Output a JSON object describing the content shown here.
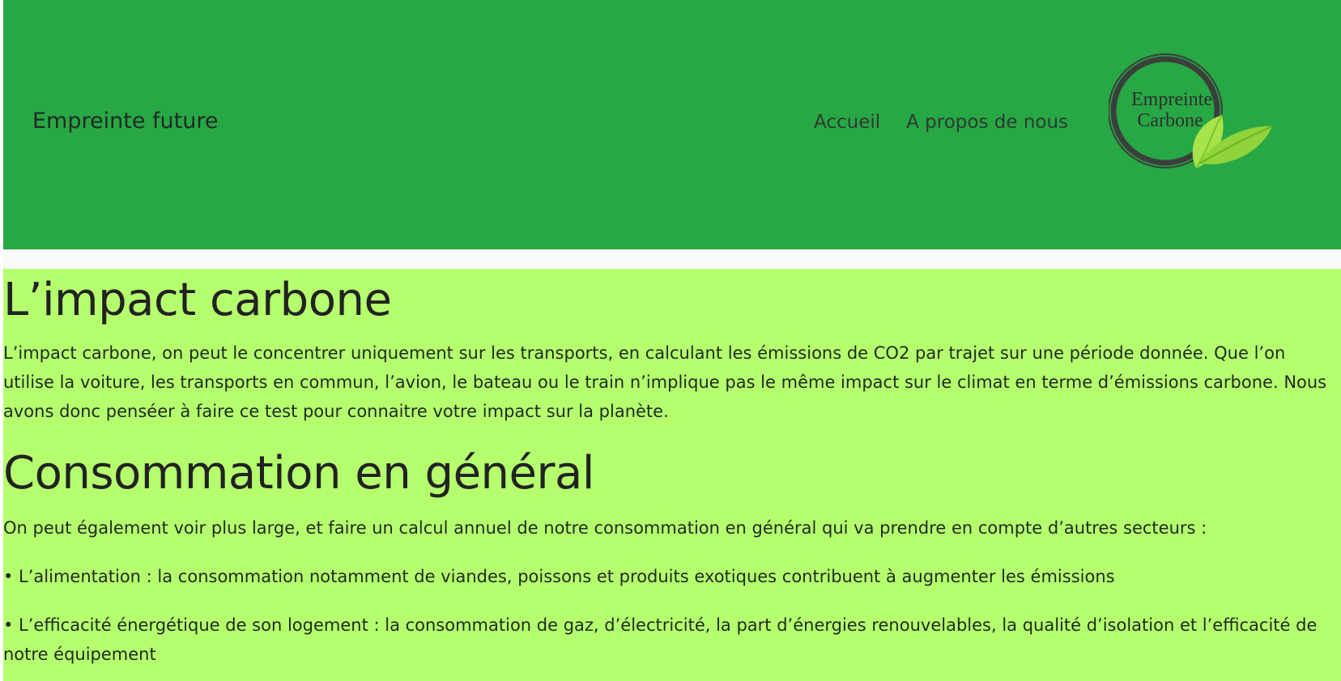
{
  "header": {
    "brand": "Empreinte future",
    "nav": {
      "home": "Accueil",
      "about": "A propos de nous"
    },
    "logo": {
      "line1": "Empreinte",
      "line2": "Carbone"
    }
  },
  "sections": {
    "impact": {
      "title": "L’impact carbone",
      "text": "L’impact carbone, on peut le concentrer uniquement sur les transports, en calculant les émissions de CO2 par trajet sur une période donnée. Que l’on utilise la voiture, les transports en commun, l’avion, le bateau ou le train n’implique pas le même impact sur le climat en terme d’émissions carbone. Nous avons donc penséer à faire ce test pour connaitre votre impact sur la planète."
    },
    "consommation": {
      "title": "Consommation en général",
      "intro": "On peut également voir plus large, et faire un calcul annuel de notre consommation en général qui va prendre en compte d’autres secteurs :",
      "alimentation": "• L’alimentation : la consommation notamment de viandes, poissons et produits exotiques contribuent à augmenter les émissions",
      "logement": "• L’efficacité énergétique de son logement : la consommation de gaz, d’électricité, la part d’énergies renouvelables, la qualité d’isolation et l’efficacité de notre équipement"
    }
  },
  "colors": {
    "header_bg": "#28a745",
    "content_bg": "#b5ff6f",
    "leaf_light": "#a7e34a",
    "leaf_dark": "#7cc62a",
    "ring": "#3a3f3c"
  },
  "icons": {
    "logo": "leaf-ring-logo-icon"
  }
}
